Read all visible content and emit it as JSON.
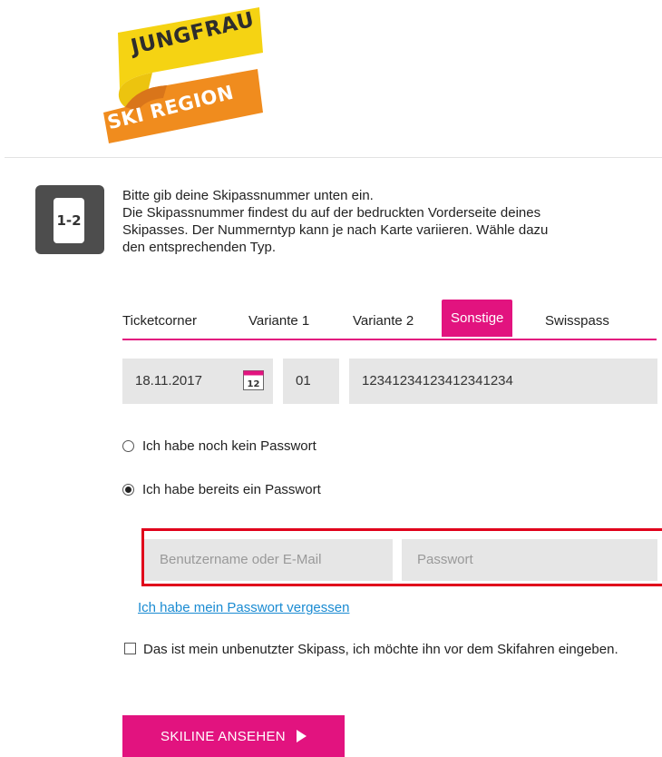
{
  "logo": {
    "line1": "JUNGFRAU",
    "line2": "SKI REGION",
    "colors": {
      "yellow": "#f5d313",
      "orange": "#f08c1e",
      "dark": "#2d2d2d"
    }
  },
  "step": {
    "badge": "1-2",
    "intro_lines": [
      "Bitte gib deine Skipassnummer unten ein.",
      "Die Skipassnummer findest du auf der bedruckten Vorderseite deines",
      "Skipasses. Der Nummerntyp kann je nach Karte variieren. Wähle dazu",
      "den entsprechenden Typ."
    ]
  },
  "tabs": [
    {
      "label": "Ticketcorner",
      "active": false
    },
    {
      "label": "Variante 1",
      "active": false
    },
    {
      "label": "Variante 2",
      "active": false
    },
    {
      "label": "Sonstige",
      "active": true
    },
    {
      "label": "Swisspass",
      "active": false
    }
  ],
  "pass_fields": {
    "date": "18.11.2017",
    "calendar_day": "12",
    "prefix": "01",
    "number": "12341234123412341234"
  },
  "password_options": {
    "no_password": "Ich habe noch kein Passwort",
    "has_password": "Ich habe bereits ein Passwort",
    "selected": "has_password"
  },
  "login": {
    "username_placeholder": "Benutzername oder E-Mail",
    "password_placeholder": "Passwort",
    "forgot_link": "Ich habe mein Passwort vergessen"
  },
  "unused_pass": {
    "label": "Das ist mein unbenutzter Skipass, ich möchte ihn vor dem Skifahren eingeben.",
    "checked": false
  },
  "cta": {
    "label": "SKILINE ANSEHEN"
  },
  "colors": {
    "accent": "#e2137f",
    "highlight_border": "#e0001b",
    "link": "#1a8bd2",
    "field_bg": "#e6e6e6"
  }
}
